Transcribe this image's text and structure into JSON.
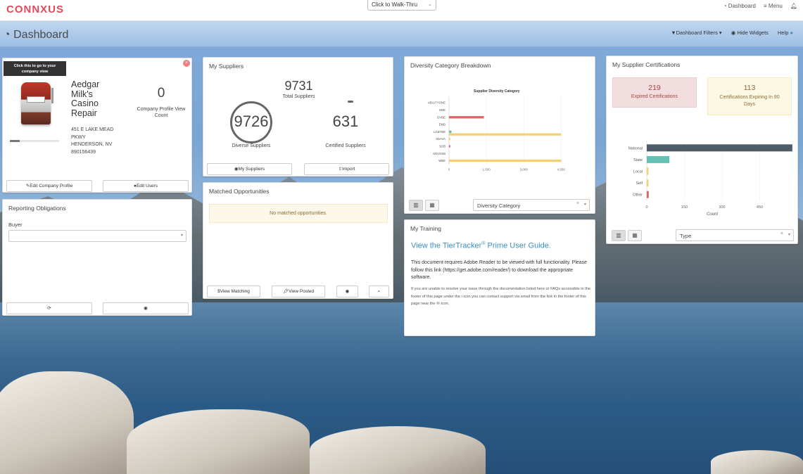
{
  "topbar": {
    "logo": "CONNXUS",
    "walkthru": "Click to Walk-Thru",
    "links": [
      "Dashboard",
      "Menu"
    ]
  },
  "header": {
    "title": "Dashboard",
    "filters": "Dashboard Filters",
    "hide_widgets": "Hide Widgets",
    "help": "Help"
  },
  "profile": {
    "tooltip_line1": "Click this to go to your",
    "tooltip_line2": "company view",
    "company_lines": [
      "Aedgar",
      "Milk's",
      "Casino",
      "Repair"
    ],
    "address_lines": [
      "451 E LAKE MEAD",
      "PKWY",
      "HENDERSON, NV",
      "890156439"
    ],
    "view_count": "0",
    "view_count_label": "Company Profile View Count",
    "edit_profile": "Edit Company Profile",
    "edit_users": "Edit Users"
  },
  "reporting": {
    "title": "Reporting Obligations",
    "buyer_label": "Buyer"
  },
  "suppliers": {
    "title": "My Suppliers",
    "total": "9731",
    "total_label": "Total Suppliers",
    "diverse": "9726",
    "diverse_label": "Diverse Suppliers",
    "certified": "631",
    "certified_label": "Certified Suppliers",
    "my_suppliers_btn": "My Suppliers",
    "import_btn": "Import"
  },
  "matched": {
    "title": "Matched Opportunities",
    "empty": "No matched opportunities.",
    "view_matching": "View Matching",
    "view_posted": "View Posted"
  },
  "diversity": {
    "title": "Diversity Category Breakdown",
    "select": "Diversity Category"
  },
  "training": {
    "title": "My Training",
    "link_prefix": "View the TierTracker",
    "link_sup": "®",
    "link_suffix": " Prime User Guide.",
    "para1": "This document requires Adobe Reader to be viewed with full functionality. Please follow this link (https://get.adobe.com/reader/) to download the appropriate software.",
    "para2": "If you are unable to resolve your issue through the documentation listed here or FAQs accessible in the footer of this page under the i icon you can contact support via email from the link in the footer of this page near the ✉ icon."
  },
  "certs": {
    "title": "My Supplier Certifications",
    "expired": "219",
    "expired_label": "Expired Certifications",
    "expiring": "113",
    "expiring_label": "Certifications Expiring In 90 Days",
    "select": "Type"
  },
  "colors": {
    "accent": "#3a8fc2",
    "red": "#e06666",
    "teal": "#62c1b3",
    "yellow": "#f2cf72",
    "slate": "#4e5d69"
  },
  "chart_data": [
    {
      "type": "bar",
      "orientation": "horizontal",
      "title": "Supplier Diversity Category",
      "categories": [
        "ABILITYONE",
        "DBE",
        "DVBE",
        "EMB",
        "LGBTBE",
        "SDAVA",
        "SDB",
        "SDVOSB",
        "WBE"
      ],
      "values": [
        0,
        0,
        1400,
        0,
        100,
        50,
        50,
        0,
        4500
      ],
      "colors": [
        "#e06666",
        "#e06666",
        "#e06666",
        "#e06666",
        "#62c1b3",
        "#f2cf72",
        "#e06666",
        "#e06666",
        "#f2cf72"
      ],
      "extra_series": {
        "LGBTBE": 4500
      },
      "xticks": [
        "0",
        "1,500",
        "3,000",
        "4,500"
      ],
      "xlim": [
        0,
        5000
      ]
    },
    {
      "type": "bar",
      "orientation": "horizontal",
      "title": "",
      "categories": [
        "National",
        "State",
        "Local",
        "Self",
        "Other"
      ],
      "values": [
        580,
        90,
        3,
        3,
        8
      ],
      "colors": [
        "#4e5d69",
        "#62c1b3",
        "#f2cf72",
        "#f2cf72",
        "#e06666"
      ],
      "xticks": [
        "0",
        "150",
        "300",
        "450"
      ],
      "xlabel": "Count",
      "xlim": [
        0,
        600
      ]
    }
  ]
}
